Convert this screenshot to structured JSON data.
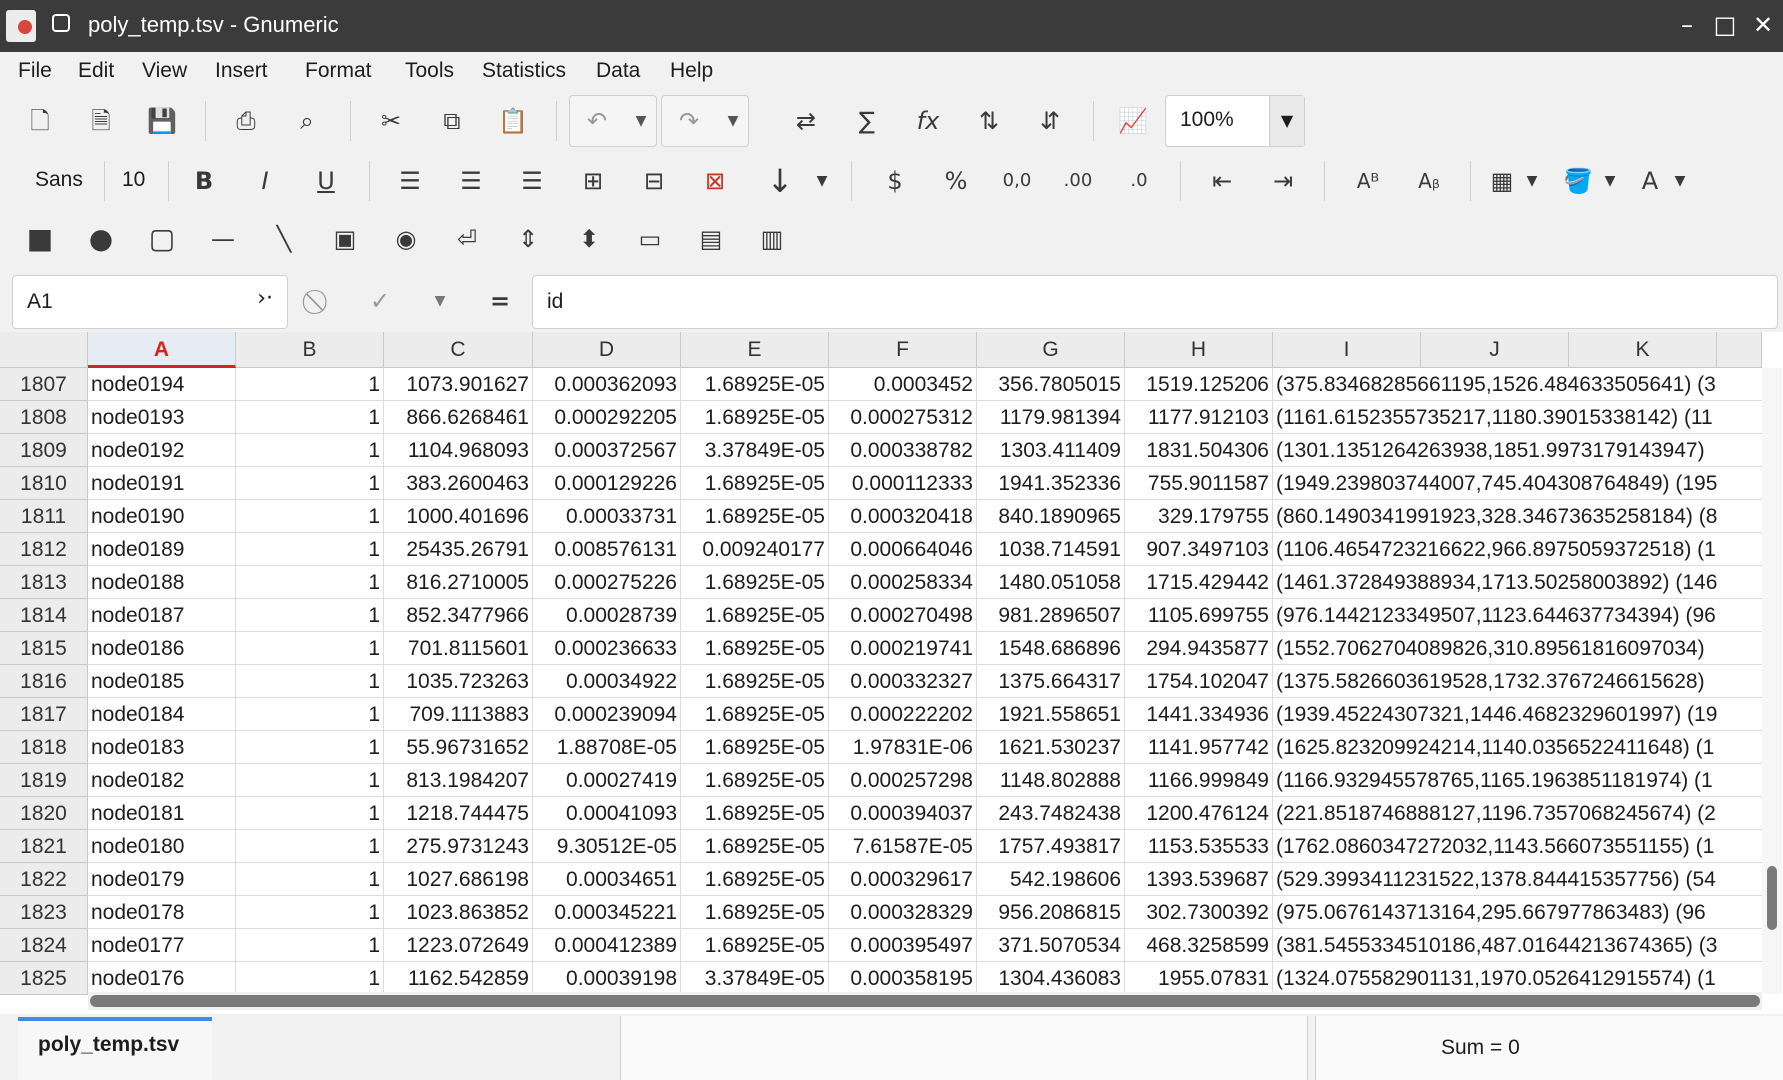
{
  "window": {
    "title": "poly_temp.tsv - Gnumeric"
  },
  "menu": [
    "File",
    "Edit",
    "View",
    "Insert",
    "Format",
    "Tools",
    "Statistics",
    "Data",
    "Help"
  ],
  "toolbar": {
    "zoom": "100%",
    "font_name": "Sans",
    "font_size": "10"
  },
  "formula_bar": {
    "cell_ref": "A1",
    "content": "id"
  },
  "columns": [
    "A",
    "B",
    "C",
    "D",
    "E",
    "F",
    "G",
    "H",
    "I",
    "J",
    "K",
    ""
  ],
  "rows": [
    {
      "n": "1807",
      "a": "node0194",
      "b": "1",
      "c": "1073.901627",
      "d": "0.000362093",
      "e": "1.68925E-05",
      "f": "0.0003452",
      "g": "356.7805015",
      "h": "1519.125206",
      "i": "(375.83468285661195,1526.484633505641) (3"
    },
    {
      "n": "1808",
      "a": "node0193",
      "b": "1",
      "c": "866.6268461",
      "d": "0.000292205",
      "e": "1.68925E-05",
      "f": "0.000275312",
      "g": "1179.981394",
      "h": "1177.912103",
      "i": "(1161.6152355735217,1180.39015338142) (11"
    },
    {
      "n": "1809",
      "a": "node0192",
      "b": "1",
      "c": "1104.968093",
      "d": "0.000372567",
      "e": "3.37849E-05",
      "f": "0.000338782",
      "g": "1303.411409",
      "h": "1831.504306",
      "i": "(1301.1351264263938,1851.9973179143947)"
    },
    {
      "n": "1810",
      "a": "node0191",
      "b": "1",
      "c": "383.2600463",
      "d": "0.000129226",
      "e": "1.68925E-05",
      "f": "0.000112333",
      "g": "1941.352336",
      "h": "755.9011587",
      "i": "(1949.239803744007,745.404308764849) (195"
    },
    {
      "n": "1811",
      "a": "node0190",
      "b": "1",
      "c": "1000.401696",
      "d": "0.00033731",
      "e": "1.68925E-05",
      "f": "0.000320418",
      "g": "840.1890965",
      "h": "329.179755",
      "i": "(860.1490341991923,328.34673635258184) (8"
    },
    {
      "n": "1812",
      "a": "node0189",
      "b": "1",
      "c": "25435.26791",
      "d": "0.008576131",
      "e": "0.009240177",
      "f": "0.000664046",
      "g": "1038.714591",
      "h": "907.3497103",
      "i": "(1106.4654723216622,966.8975059372518) (1"
    },
    {
      "n": "1813",
      "a": "node0188",
      "b": "1",
      "c": "816.2710005",
      "d": "0.000275226",
      "e": "1.68925E-05",
      "f": "0.000258334",
      "g": "1480.051058",
      "h": "1715.429442",
      "i": "(1461.372849388934,1713.50258003892) (146"
    },
    {
      "n": "1814",
      "a": "node0187",
      "b": "1",
      "c": "852.3477966",
      "d": "0.00028739",
      "e": "1.68925E-05",
      "f": "0.000270498",
      "g": "981.2896507",
      "h": "1105.699755",
      "i": "(976.1442123349507,1123.644637734394) (96"
    },
    {
      "n": "1815",
      "a": "node0186",
      "b": "1",
      "c": "701.8115601",
      "d": "0.000236633",
      "e": "1.68925E-05",
      "f": "0.000219741",
      "g": "1548.686896",
      "h": "294.9435877",
      "i": "(1552.7062704089826,310.89561816097034)"
    },
    {
      "n": "1816",
      "a": "node0185",
      "b": "1",
      "c": "1035.723263",
      "d": "0.00034922",
      "e": "1.68925E-05",
      "f": "0.000332327",
      "g": "1375.664317",
      "h": "1754.102047",
      "i": "(1375.5826603619528,1732.3767246615628)"
    },
    {
      "n": "1817",
      "a": "node0184",
      "b": "1",
      "c": "709.1113883",
      "d": "0.000239094",
      "e": "1.68925E-05",
      "f": "0.000222202",
      "g": "1921.558651",
      "h": "1441.334936",
      "i": "(1939.45224307321,1446.4682329601997) (19"
    },
    {
      "n": "1818",
      "a": "node0183",
      "b": "1",
      "c": "55.96731652",
      "d": "1.88708E-05",
      "e": "1.68925E-05",
      "f": "1.97831E-06",
      "g": "1621.530237",
      "h": "1141.957742",
      "i": "(1625.823209924214,1140.0356522411648) (1"
    },
    {
      "n": "1819",
      "a": "node0182",
      "b": "1",
      "c": "813.1984207",
      "d": "0.00027419",
      "e": "1.68925E-05",
      "f": "0.000257298",
      "g": "1148.802888",
      "h": "1166.999849",
      "i": "(1166.932945578765,1165.1963851181974) (1"
    },
    {
      "n": "1820",
      "a": "node0181",
      "b": "1",
      "c": "1218.744475",
      "d": "0.00041093",
      "e": "1.68925E-05",
      "f": "0.000394037",
      "g": "243.7482438",
      "h": "1200.476124",
      "i": "(221.8518746888127,1196.7357068245674) (2"
    },
    {
      "n": "1821",
      "a": "node0180",
      "b": "1",
      "c": "275.9731243",
      "d": "9.30512E-05",
      "e": "1.68925E-05",
      "f": "7.61587E-05",
      "g": "1757.493817",
      "h": "1153.535533",
      "i": "(1762.0860347272032,1143.566073551155) (1"
    },
    {
      "n": "1822",
      "a": "node0179",
      "b": "1",
      "c": "1027.686198",
      "d": "0.00034651",
      "e": "1.68925E-05",
      "f": "0.000329617",
      "g": "542.198606",
      "h": "1393.539687",
      "i": "(529.3993411231522,1378.844415357756) (54"
    },
    {
      "n": "1823",
      "a": "node0178",
      "b": "1",
      "c": "1023.863852",
      "d": "0.000345221",
      "e": "1.68925E-05",
      "f": "0.000328329",
      "g": "956.2086815",
      "h": "302.7300392",
      "i": "(975.0676143713164,295.667977863483) (96"
    },
    {
      "n": "1824",
      "a": "node0177",
      "b": "1",
      "c": "1223.072649",
      "d": "0.000412389",
      "e": "1.68925E-05",
      "f": "0.000395497",
      "g": "371.5070534",
      "h": "468.3258599",
      "i": "(381.5455334510186,487.01644213674365) (3"
    },
    {
      "n": "1825",
      "a": "node0176",
      "b": "1",
      "c": "1162.542859",
      "d": "0.00039198",
      "e": "3.37849E-05",
      "f": "0.000358195",
      "g": "1304.436083",
      "h": "1955.07831",
      "i": "(1324.075582901131,1970.0526412915574) (1"
    }
  ],
  "sheet_tab": "poly_temp.tsv",
  "status": {
    "sum": "Sum = 0"
  }
}
